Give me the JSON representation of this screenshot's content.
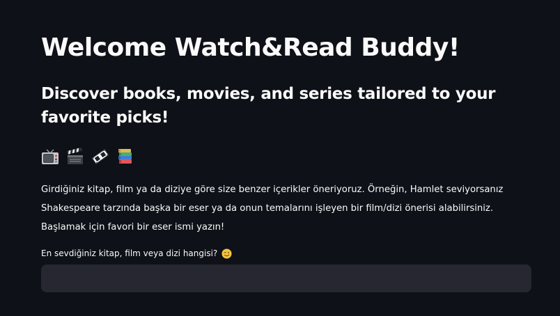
{
  "page": {
    "title": "Welcome Watch&Read Buddy!",
    "subtitle": "Discover books, movies, and series tailored to your favorite picks!",
    "emojis": [
      "television-icon",
      "clapper-board-icon",
      "film-frames-icon",
      "books-icon"
    ],
    "intro_text": "Girdiğiniz kitap, film ya da diziye göre size benzer içerikler öneriyoruz. Örneğin, Hamlet seviyorsanız Shakespeare tarzında başka bir eser ya da onun temalarını işleyen bir film/dizi önerisi alabilirsiniz. Başlamak için favori bir eser ismi yazın!"
  },
  "search": {
    "label": "En sevdiğiniz kitap, film veya dizi hangisi?",
    "label_icon": "winking-face-icon",
    "value": "",
    "placeholder": ""
  },
  "colors": {
    "background": "#0e1117",
    "text": "#fafafa",
    "input_background": "#262730"
  }
}
